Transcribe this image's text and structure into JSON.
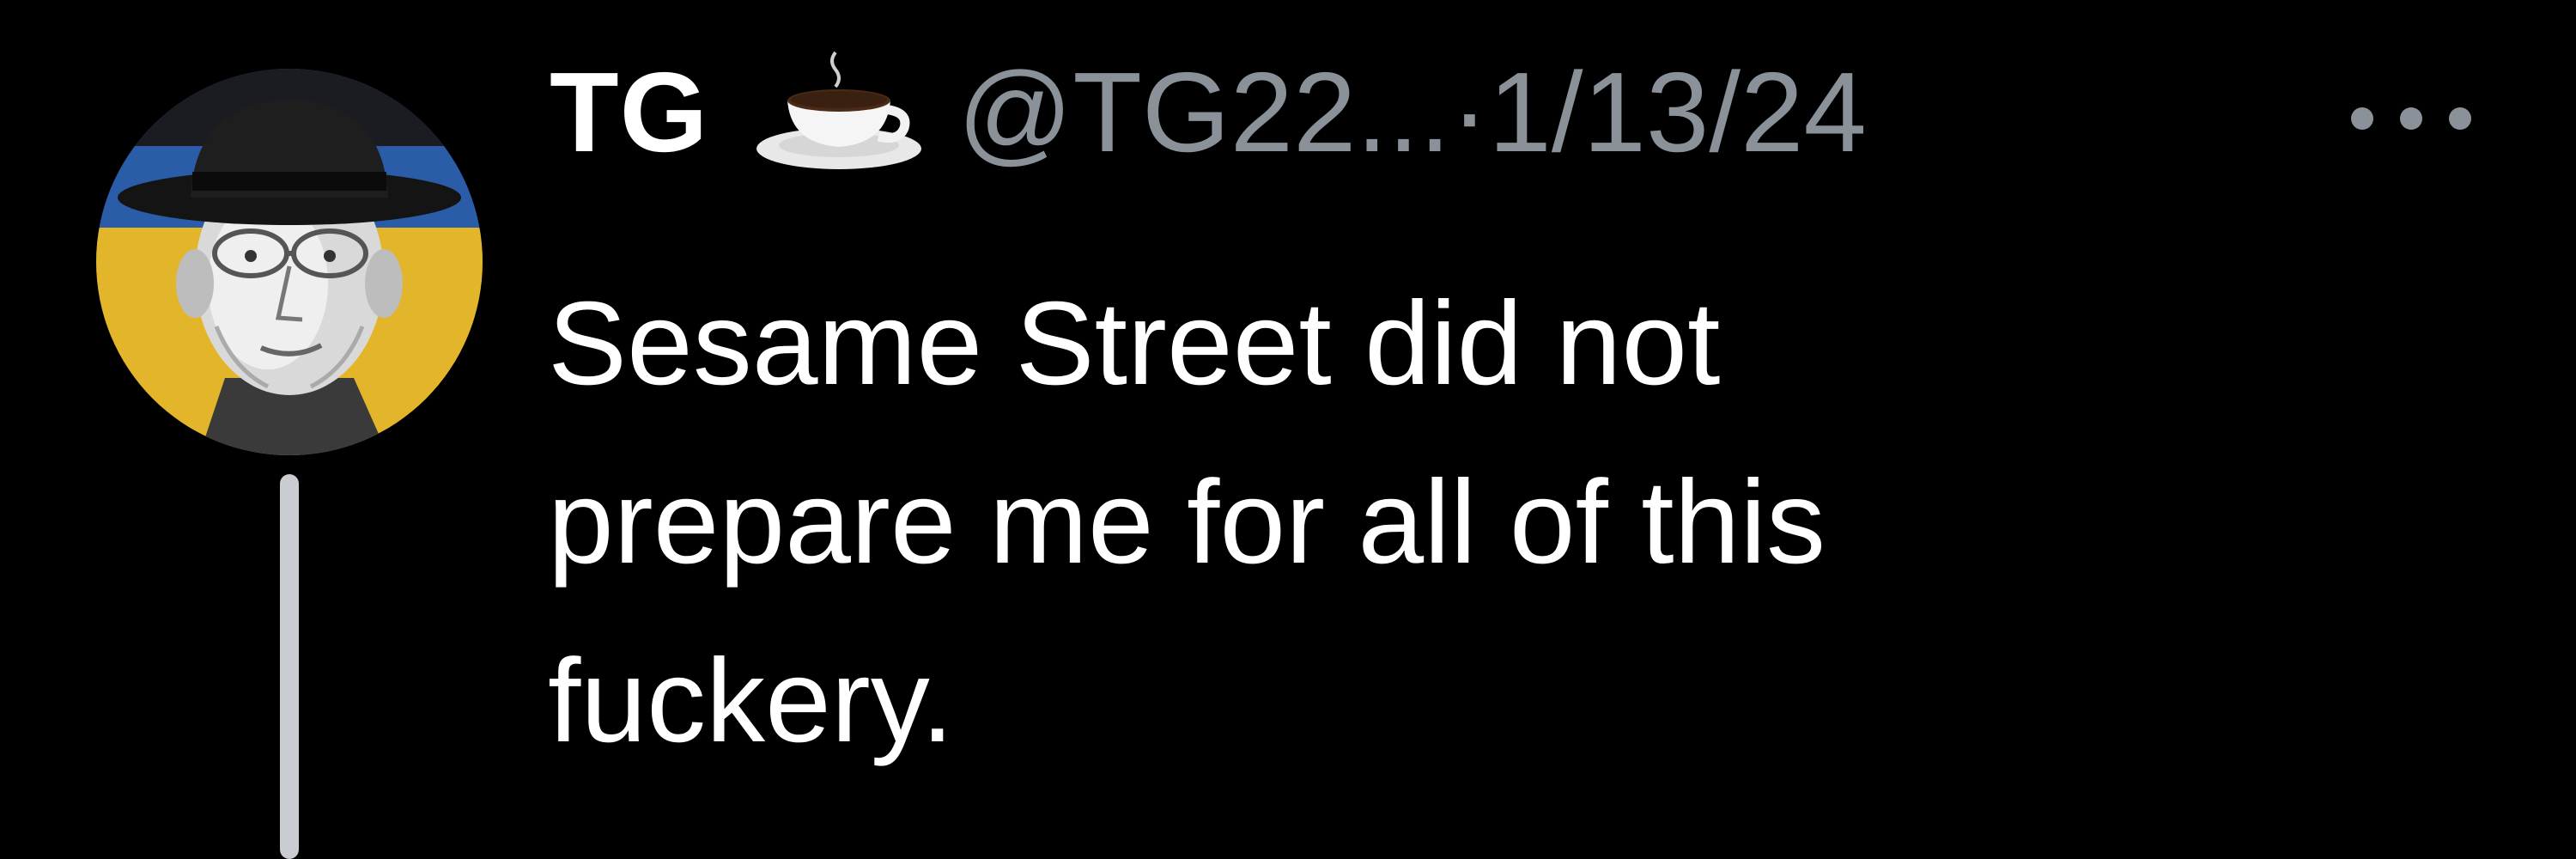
{
  "tweet": {
    "author_name": "TG",
    "author_emoji": "coffee-cup-icon",
    "handle": "@TG22...",
    "separator": "·",
    "date": "1/13/24",
    "more_icon": "more-horizontal-icon",
    "text": "Sesame Street did not\nprepare me for all of this\nfuckery."
  },
  "colors": {
    "background": "#000000",
    "text_primary": "#ffffff",
    "text_secondary": "#8a9199",
    "thread_line": "#c9ccd1"
  }
}
